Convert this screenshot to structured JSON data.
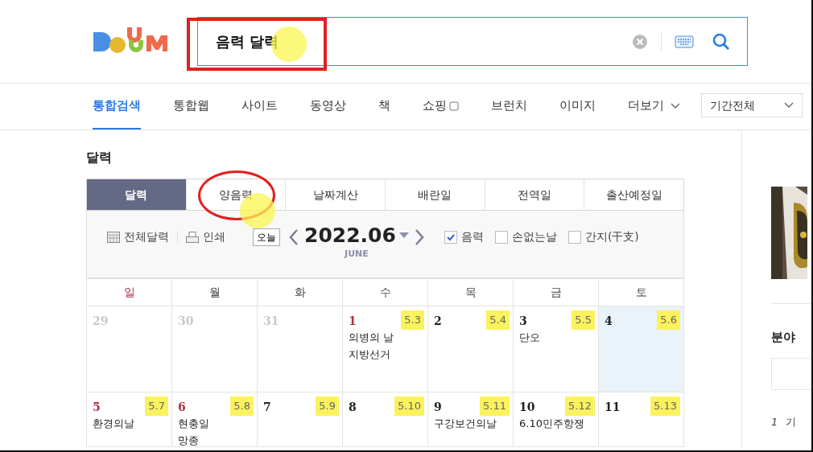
{
  "search": {
    "value": "음력 달력"
  },
  "nav": [
    {
      "label": "통합검색",
      "selected": true
    },
    {
      "label": "통합웹",
      "selected": false
    },
    {
      "label": "사이트",
      "selected": false
    },
    {
      "label": "동영상",
      "selected": false
    },
    {
      "label": "책",
      "selected": false
    },
    {
      "label": "쇼핑",
      "selected": false,
      "kind": "shopping"
    },
    {
      "label": "브런치",
      "selected": false
    },
    {
      "label": "이미지",
      "selected": false
    },
    {
      "label": "더보기",
      "selected": false,
      "kind": "more"
    }
  ],
  "period_select": {
    "value": "기간전체"
  },
  "section_title": "달력",
  "tabs": [
    {
      "label": "달력",
      "selected": true
    },
    {
      "label": "양음력",
      "selected": false
    },
    {
      "label": "날짜계산",
      "selected": false
    },
    {
      "label": "배란일",
      "selected": false
    },
    {
      "label": "전역일",
      "selected": false
    },
    {
      "label": "출산예정일",
      "selected": false
    }
  ],
  "toolbar": {
    "full_calendar": "전체달력",
    "print": "인쇄",
    "today": "오늘",
    "month": "2022.06",
    "month_name": "JUNE"
  },
  "options": [
    {
      "label": "음력",
      "checked": true
    },
    {
      "label": "손없는날",
      "checked": false
    },
    {
      "label": "간지(干支)",
      "checked": false
    }
  ],
  "weekdays": [
    {
      "label": "일",
      "holiday": true
    },
    {
      "label": "월",
      "holiday": false
    },
    {
      "label": "화",
      "holiday": false
    },
    {
      "label": "수",
      "holiday": false
    },
    {
      "label": "목",
      "holiday": false
    },
    {
      "label": "금",
      "holiday": false
    },
    {
      "label": "토",
      "holiday": false
    }
  ],
  "weeks": [
    [
      {
        "day": "29",
        "muted": true,
        "holiday": false,
        "selected": false
      },
      {
        "day": "30",
        "muted": true,
        "holiday": false,
        "selected": false
      },
      {
        "day": "31",
        "muted": true,
        "holiday": false,
        "selected": false
      },
      {
        "day": "1",
        "lunar": "5.3",
        "muted": false,
        "holiday": true,
        "selected": false,
        "events": [
          "의병의 날",
          "지방선거"
        ]
      },
      {
        "day": "2",
        "lunar": "5.4",
        "muted": false,
        "holiday": false,
        "selected": false
      },
      {
        "day": "3",
        "lunar": "5.5",
        "muted": false,
        "holiday": false,
        "selected": false,
        "events": [
          "단오"
        ]
      },
      {
        "day": "4",
        "lunar": "5.6",
        "muted": false,
        "holiday": false,
        "selected": true
      }
    ],
    [
      {
        "day": "5",
        "lunar": "5.7",
        "muted": false,
        "holiday": true,
        "selected": false,
        "events": [
          "환경의날"
        ]
      },
      {
        "day": "6",
        "lunar": "5.8",
        "muted": false,
        "holiday": true,
        "selected": false,
        "events": [
          "현충일",
          "망종"
        ]
      },
      {
        "day": "7",
        "lunar": "5.9",
        "muted": false,
        "holiday": false,
        "selected": false
      },
      {
        "day": "8",
        "lunar": "5.10",
        "muted": false,
        "holiday": false,
        "selected": false
      },
      {
        "day": "9",
        "lunar": "5.11",
        "muted": false,
        "holiday": false,
        "selected": false,
        "events": [
          "구강보건의날"
        ]
      },
      {
        "day": "10",
        "lunar": "5.12",
        "muted": false,
        "holiday": false,
        "selected": false,
        "events": [
          "6.10민주항쟁"
        ]
      },
      {
        "day": "11",
        "lunar": "5.13",
        "muted": false,
        "holiday": false,
        "selected": false
      }
    ]
  ],
  "side": {
    "title": "분야",
    "list_number": "1",
    "list_text": "기"
  }
}
